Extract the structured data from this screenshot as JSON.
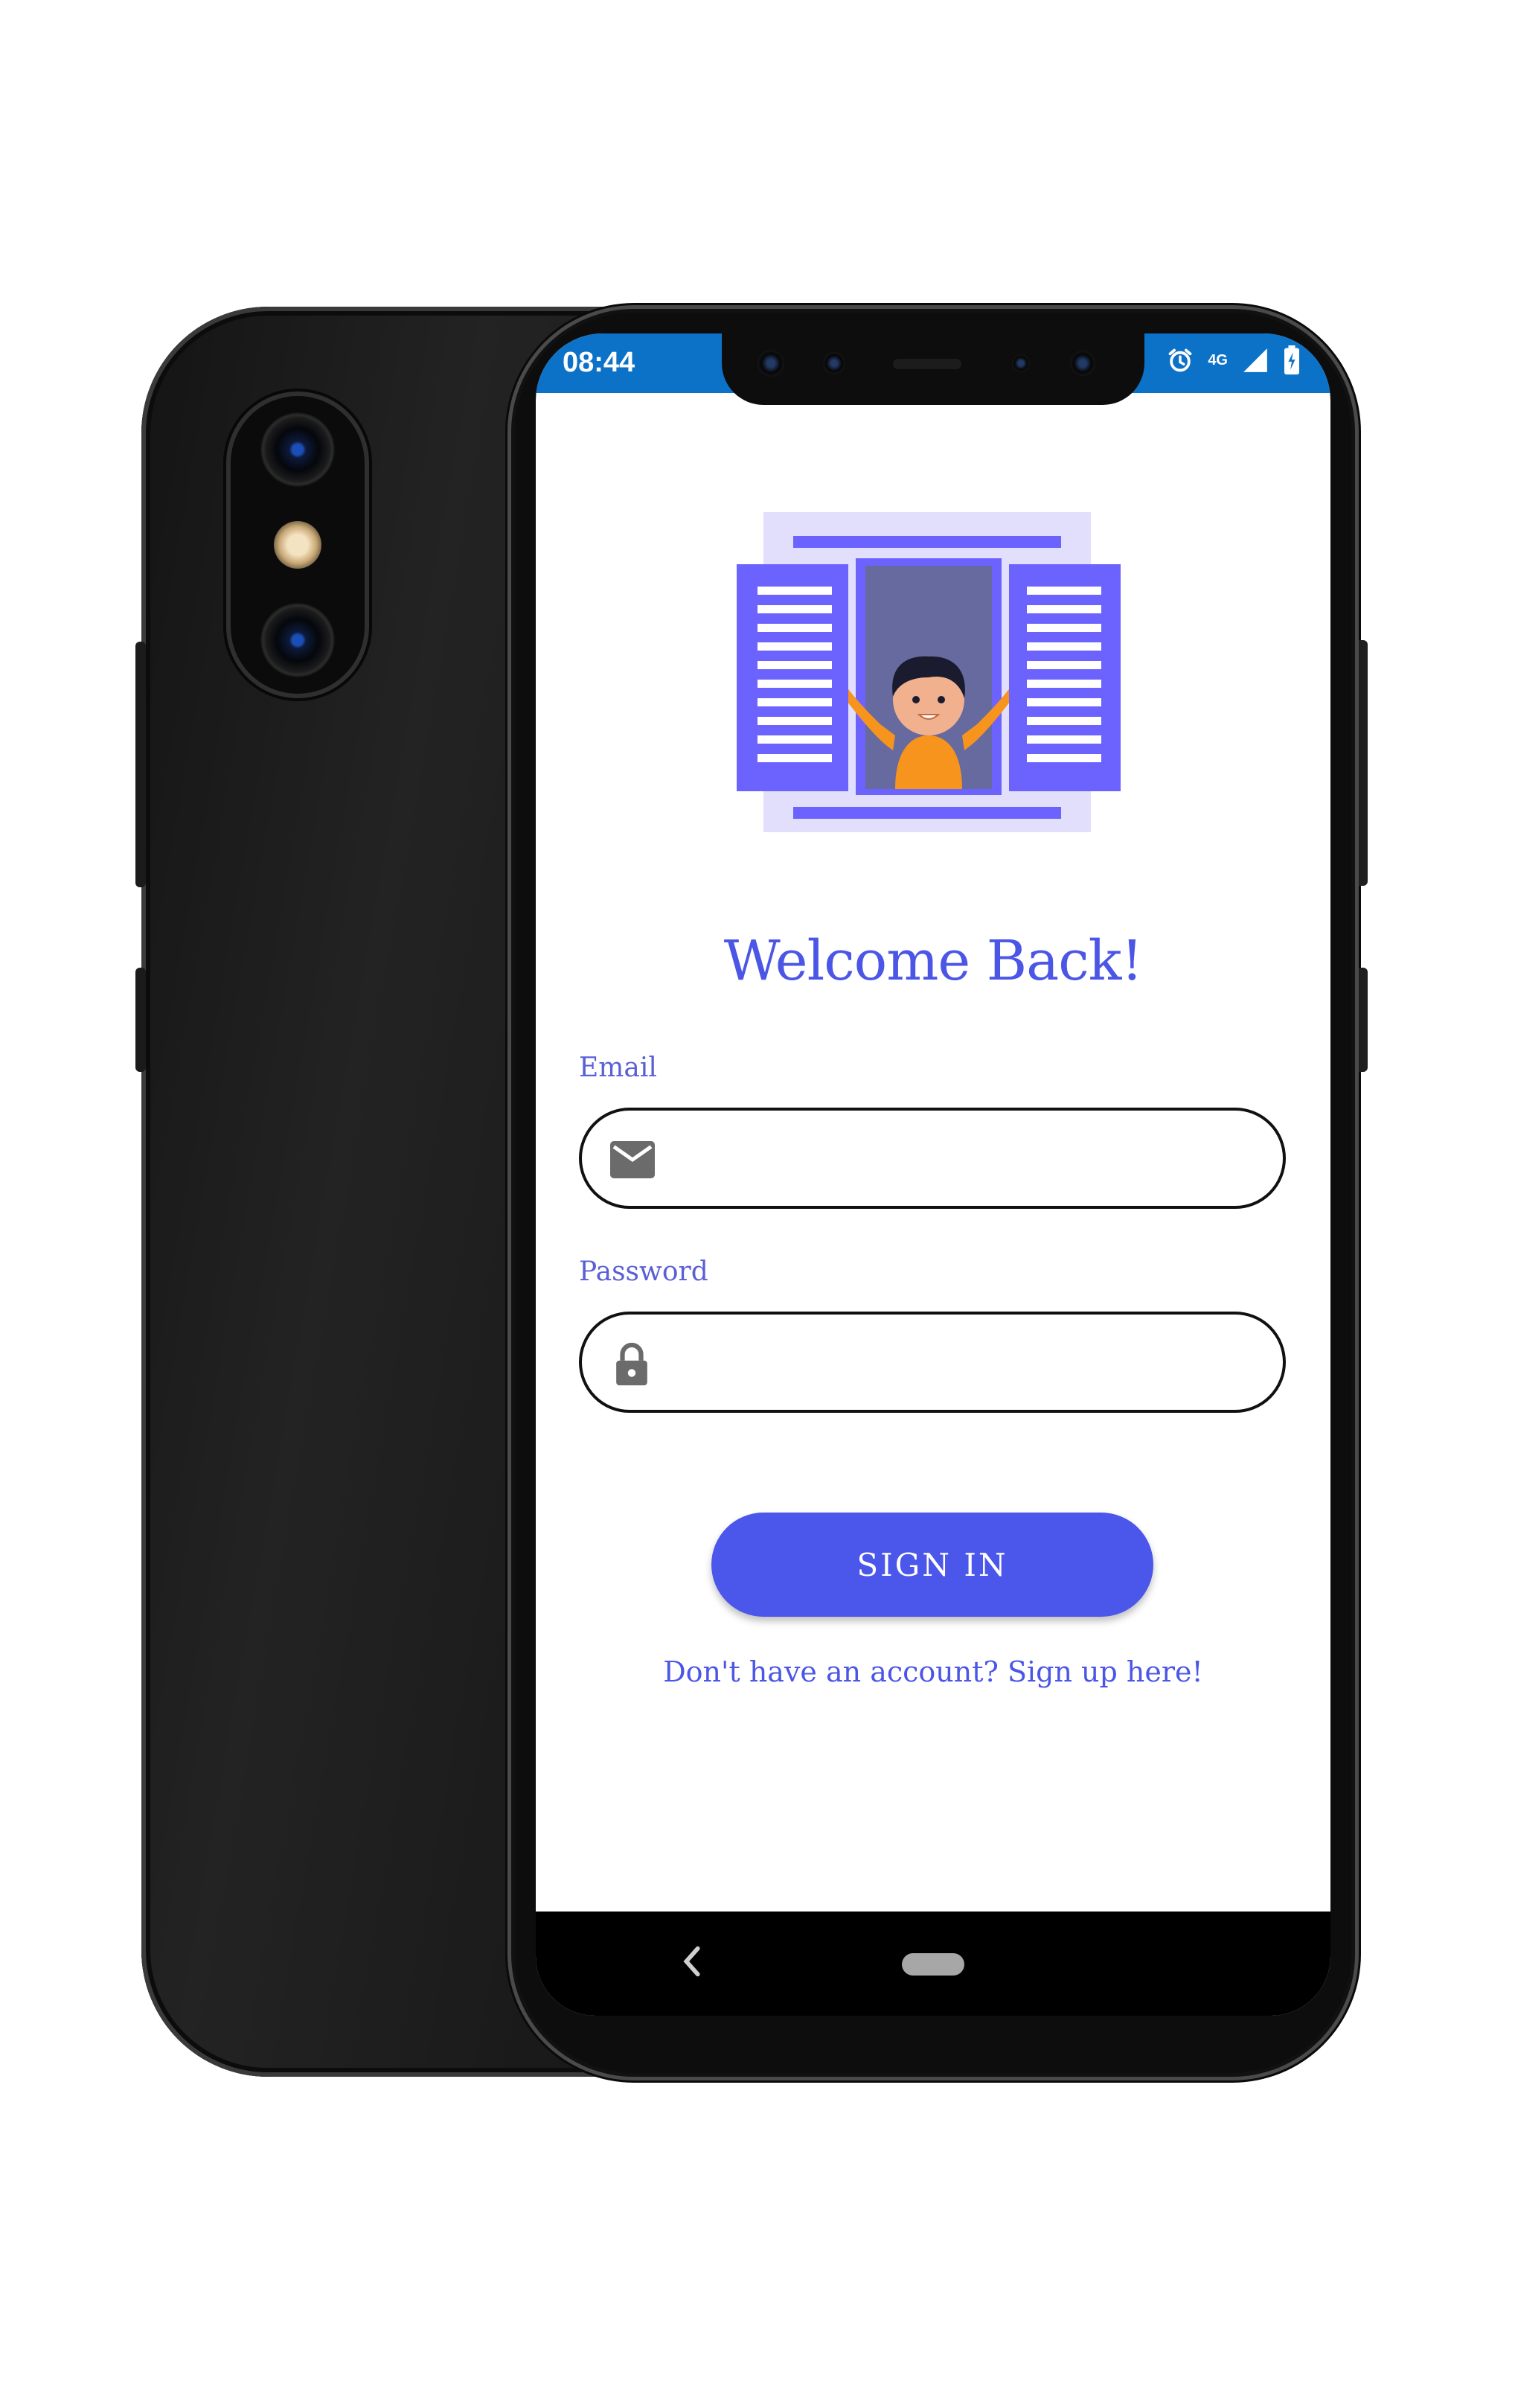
{
  "status_bar": {
    "time": "08:44",
    "network": "4G",
    "color": "#0c72c8"
  },
  "login": {
    "title": "Welcome Back!",
    "email_label": "Email",
    "email_value": "",
    "password_label": "Password",
    "password_value": "",
    "sign_in_label": "SIGN IN",
    "signup_link": "Don't have an account? Sign up here!"
  },
  "icons": {
    "email_field": "envelope-icon",
    "password_field": "lock-icon",
    "status": [
      "alarm-icon",
      "signal-icon",
      "battery-icon"
    ],
    "nav": [
      "back-icon",
      "home-pill"
    ]
  },
  "colors": {
    "accent": "#4b56e6",
    "button": "#4b56ea",
    "illustration_purple": "#6c63ff",
    "illustration_orange": "#f7941d"
  }
}
